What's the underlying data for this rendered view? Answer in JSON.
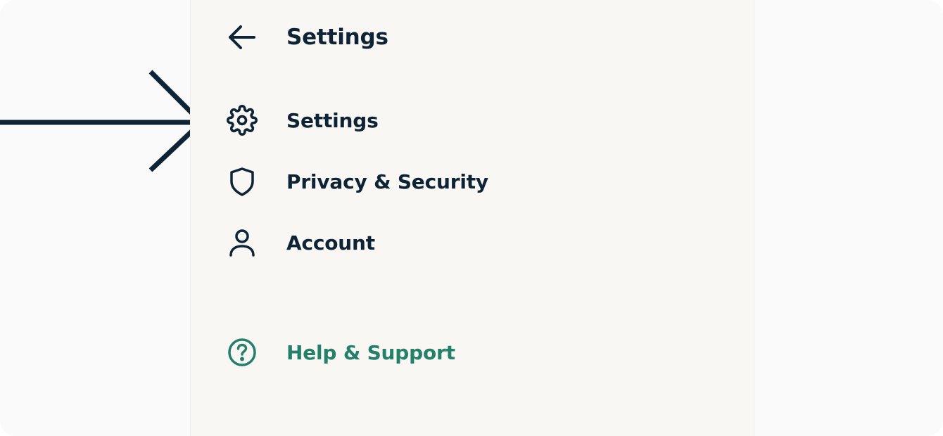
{
  "header": {
    "title": "Settings",
    "back_icon": "arrow-left-icon"
  },
  "menu": {
    "items": [
      {
        "label": "Settings",
        "icon": "gear-icon"
      },
      {
        "label": "Privacy & Security",
        "icon": "shield-icon"
      },
      {
        "label": "Account",
        "icon": "user-icon"
      }
    ],
    "help": {
      "label": "Help & Support",
      "icon": "help-circle-icon"
    }
  },
  "colors": {
    "text": "#0e2436",
    "accent": "#25806a",
    "panel_background": "#f8f7f3",
    "page_background": "#fafafa"
  }
}
